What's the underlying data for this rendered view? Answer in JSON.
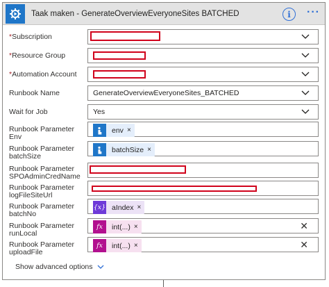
{
  "header": {
    "title": "Taak maken - GenerateOverviewEveryoneSites BATCHED",
    "info_icon": "i",
    "more_icon": "···"
  },
  "fields": [
    {
      "label": "Subscription",
      "required": true,
      "value": "",
      "kind": "dropdown",
      "redacted": true
    },
    {
      "label": "Resource Group",
      "required": true,
      "value": "",
      "kind": "dropdown",
      "redacted": true
    },
    {
      "label": "Automation Account",
      "required": true,
      "value": "",
      "kind": "dropdown",
      "redacted": true
    },
    {
      "label": "Runbook Name",
      "required": false,
      "value": "GenerateOverviewEveryoneSites_BATCHED",
      "kind": "dropdown"
    },
    {
      "label": "Wait for Job",
      "required": false,
      "value": "Yes",
      "kind": "dropdown"
    },
    {
      "label": "Runbook Parameter Env",
      "kind": "token",
      "token": {
        "text": "env",
        "icon": "manual-trigger-icon",
        "color": "#1f76c8"
      }
    },
    {
      "label": "Runbook Parameter batchSize",
      "kind": "token",
      "token": {
        "text": "batchSize",
        "icon": "manual-trigger-icon",
        "color": "#1f76c8"
      }
    },
    {
      "label": "Runbook Parameter SPOAdminCredName",
      "kind": "text",
      "redacted": true
    },
    {
      "label": "Runbook Parameter logFileSiteUrl",
      "kind": "text",
      "redacted": true
    },
    {
      "label": "Runbook Parameter batchNo",
      "kind": "token",
      "token": {
        "text": "aIndex",
        "icon": "variable-icon",
        "glyph": "{x}",
        "color": "#6e3ad8"
      }
    },
    {
      "label": "Runbook Parameter runLocal",
      "kind": "token",
      "token": {
        "text": "int(...)",
        "icon": "expression-icon",
        "glyph": "fx",
        "color": "#b2108f"
      },
      "clearable": true
    },
    {
      "label": "Runbook Parameter uploadFile",
      "kind": "token",
      "token": {
        "text": "int(...)",
        "icon": "expression-icon",
        "glyph": "fx",
        "color": "#b2108f"
      },
      "clearable": true
    }
  ],
  "labels": {
    "subscription": "Subscription",
    "resource_group": "Resource Group",
    "automation_account": "Automation Account",
    "runbook_name": "Runbook Name",
    "wait_for_job": "Wait for Job",
    "param_env_1": "Runbook Parameter",
    "param_env_2": "Env",
    "param_batchsize_1": "Runbook Parameter",
    "param_batchsize_2": "batchSize",
    "param_spo_1": "Runbook Parameter",
    "param_spo_2": "SPOAdminCredName",
    "param_log_1": "Runbook Parameter",
    "param_log_2": "logFileSiteUrl",
    "param_batchno_1": "Runbook Parameter",
    "param_batchno_2": "batchNo",
    "param_runlocal_1": "Runbook Parameter",
    "param_runlocal_2": "runLocal",
    "param_upload_1": "Runbook Parameter",
    "param_upload_2": "uploadFile",
    "required_mark": "*"
  },
  "values": {
    "runbook_name": "GenerateOverviewEveryoneSites_BATCHED",
    "wait_for_job": "Yes"
  },
  "tokens": {
    "env": "env",
    "batchsize": "batchSize",
    "aindex": "aIndex",
    "runlocal": "int(...)",
    "uploadfile": "int(...)",
    "remove": "×",
    "var_glyph": "{x}",
    "fx_glyph": "fx"
  },
  "clear_glyph": "✕",
  "advanced_label": "Show advanced options",
  "colors": {
    "accent": "#1f76c8",
    "variable": "#6e3ad8",
    "expression": "#b2108f",
    "redaction": "#d0021b",
    "required": "#a4262c"
  }
}
